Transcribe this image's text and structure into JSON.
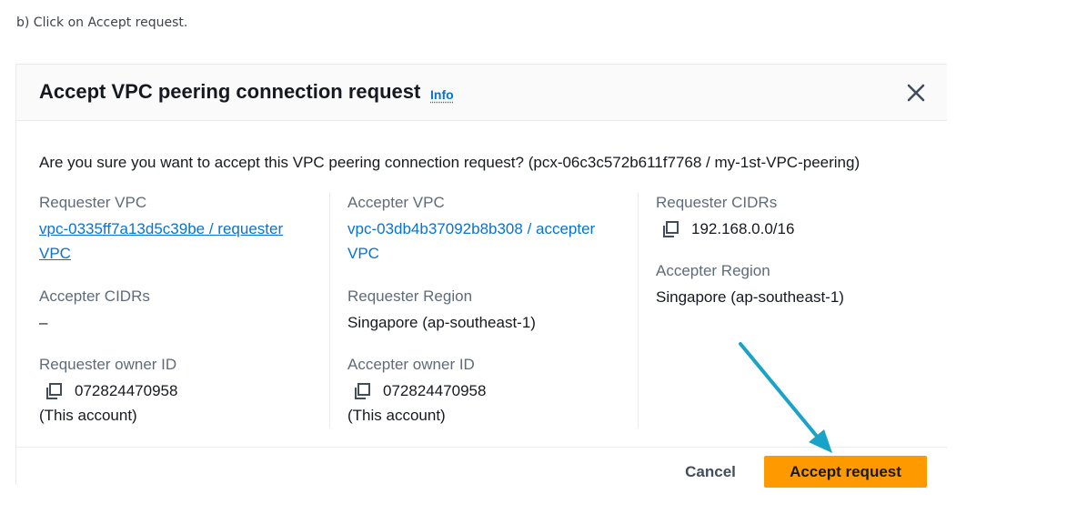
{
  "instruction": "b) Click on Accept request.",
  "modal": {
    "title": "Accept VPC peering connection request",
    "info_label": "Info",
    "question": "Are you sure you want to accept this VPC peering connection request? (pcx-06c3c572b611f7768 / my-1st-VPC-peering)",
    "requester_vpc": {
      "label": "Requester VPC",
      "value_line1": "vpc-0335ff7a13d5c39be / requester",
      "value_line2": "VPC"
    },
    "accepter_cidrs": {
      "label": "Accepter CIDRs",
      "value": "–"
    },
    "requester_owner": {
      "label": "Requester owner ID",
      "value": "072824470958",
      "note": "(This account)"
    },
    "accepter_vpc": {
      "label": "Accepter VPC",
      "value_line1": "vpc-03db4b37092b8b308 / accepter",
      "value_line2": "VPC"
    },
    "requester_region": {
      "label": "Requester Region",
      "value": "Singapore (ap-southeast-1)"
    },
    "accepter_owner": {
      "label": "Accepter owner ID",
      "value": "072824470958",
      "note": "(This account)"
    },
    "requester_cidrs": {
      "label": "Requester CIDRs",
      "value": "192.168.0.0/16"
    },
    "accepter_region": {
      "label": "Accepter Region",
      "value": "Singapore (ap-southeast-1)"
    },
    "cancel_label": "Cancel",
    "accept_label": "Accept request"
  },
  "colors": {
    "primary_button": "#ff9900",
    "link": "#0972d3",
    "annotation_arrow": "#1aa3c8"
  },
  "icons": [
    "close-icon",
    "copy-icon",
    "annotation-arrow"
  ]
}
